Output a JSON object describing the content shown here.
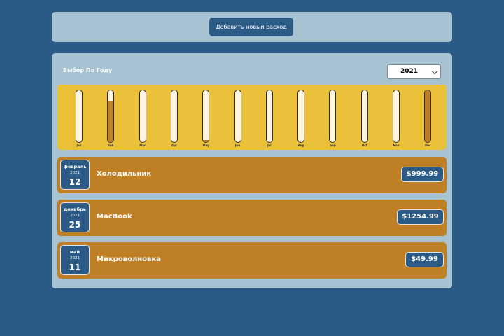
{
  "header": {
    "add_button_label": "Добавить новый расход"
  },
  "filter": {
    "label": "Выбор По Году",
    "selected_year": "2021"
  },
  "colors": {
    "background": "#2a5a85",
    "panel": "#a7c2d1",
    "chart_bg": "#ecc13a",
    "bar_fill": "#bf7f25",
    "expense_bg": "#bf7f25"
  },
  "chart_data": {
    "type": "bar",
    "categories": [
      "Jan",
      "Feb",
      "Mar",
      "Apr",
      "May",
      "Jun",
      "Jul",
      "Aug",
      "Sep",
      "Oct",
      "Nov",
      "Dec"
    ],
    "values": [
      0,
      999.99,
      0,
      0,
      49.99,
      0,
      0,
      0,
      0,
      0,
      0,
      1254.99
    ],
    "ylim": [
      0,
      1254.99
    ]
  },
  "expenses": [
    {
      "month": "февраль",
      "year": "2021",
      "day": "12",
      "title": "Холодильник",
      "price": "$999.99"
    },
    {
      "month": "декабрь",
      "year": "2021",
      "day": "25",
      "title": "MacBook",
      "price": "$1254.99"
    },
    {
      "month": "май",
      "year": "2021",
      "day": "11",
      "title": "Микроволновка",
      "price": "$49.99"
    }
  ]
}
